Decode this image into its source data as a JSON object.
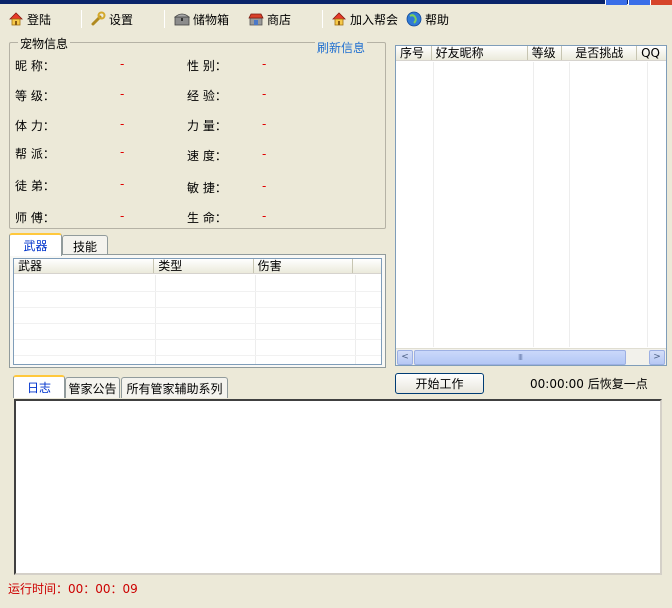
{
  "toolbar": {
    "login": "登陆",
    "settings": "设置",
    "storage": "储物箱",
    "shop": "商店",
    "join_guild": "加入帮会",
    "help": "帮助"
  },
  "pet_info": {
    "title": "宠物信息",
    "refresh": "刷新信息",
    "left": [
      {
        "label": "昵  称：",
        "value": "-"
      },
      {
        "label": "等  级：",
        "value": "-"
      },
      {
        "label": "体  力：",
        "value": "-"
      },
      {
        "label": "帮  派：",
        "value": "-"
      },
      {
        "label": "徒  弟：",
        "value": "-"
      },
      {
        "label": "师  傅：",
        "value": "-"
      }
    ],
    "right": [
      {
        "label": "性  别：",
        "value": "-"
      },
      {
        "label": "经  验：",
        "value": "-"
      },
      {
        "label": "力  量：",
        "value": "-"
      },
      {
        "label": "速  度：",
        "value": "-"
      },
      {
        "label": "敏  捷：",
        "value": "-"
      },
      {
        "label": "生  命：",
        "value": "-"
      }
    ]
  },
  "equip_tabs": [
    "武器",
    "技能"
  ],
  "weapon_table": {
    "columns": [
      "武器",
      "类型",
      "伤害"
    ]
  },
  "friends_table": {
    "columns": [
      "序号",
      "好友昵称",
      "等级",
      "是否挑战",
      "QQ"
    ]
  },
  "scrollbar": {
    "left": "<",
    "right": ">",
    "thumb": "III"
  },
  "log_tabs": [
    "日志",
    "管家公告",
    "所有管家辅助系列"
  ],
  "start_button": "开始工作",
  "recover_text": "00:00:00 后恢复一点",
  "runtime": "运行时间：00：00：09"
}
